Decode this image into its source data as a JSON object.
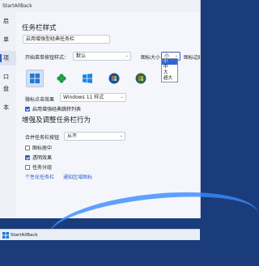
{
  "window": {
    "title": "StartAllBack"
  },
  "sidebar": {
    "items": [
      {
        "label": "启"
      },
      {
        "label": "单"
      },
      {
        "label": "项"
      },
      {
        "label": "口"
      },
      {
        "label": "盘"
      },
      {
        "label": "本"
      }
    ],
    "active_index": 2
  },
  "section1": {
    "title": "任务栏样式",
    "enhanced_taskbar_button": "启用增强型经典任务栏",
    "start_button_label": "开始菜单按钮样式：",
    "start_button_value": "默认",
    "icon_size_label": "图标大小",
    "icon_size_value": "小",
    "icon_spacing_label": "图标边距",
    "icon_size_options": [
      "小",
      "中",
      "大",
      "超大"
    ],
    "icon_size_selected": "小",
    "start_styles": [
      {
        "name": "start-style-windows11",
        "selected": true
      },
      {
        "name": "start-style-clover",
        "selected": false
      },
      {
        "name": "start-style-windows10",
        "selected": false
      },
      {
        "name": "start-style-windows7-orb",
        "selected": false
      },
      {
        "name": "start-style-windows-vista-orb",
        "selected": false
      }
    ],
    "win_key_label": "微标点击效果",
    "win_key_value": "Windows 11 样式",
    "jump_list_checkbox": {
      "label": "启用增强经典跳转列表",
      "checked": true
    }
  },
  "section2": {
    "title": "增强及调整任务栏行为",
    "combine_label": "合并任务栏按钮",
    "combine_value": "从不",
    "checkboxes": [
      {
        "label": "图标居中",
        "checked": false
      },
      {
        "label": "透明效果",
        "checked": true
      },
      {
        "label": "任务分组",
        "checked": false
      }
    ],
    "links": [
      "个性化任务栏",
      "通知区域图标"
    ]
  },
  "taskbar": {
    "label": "StartAllBack"
  },
  "colors": {
    "accent": "#2f5ec4",
    "link": "#2a62c9",
    "desktop": "#1b3c7a"
  }
}
